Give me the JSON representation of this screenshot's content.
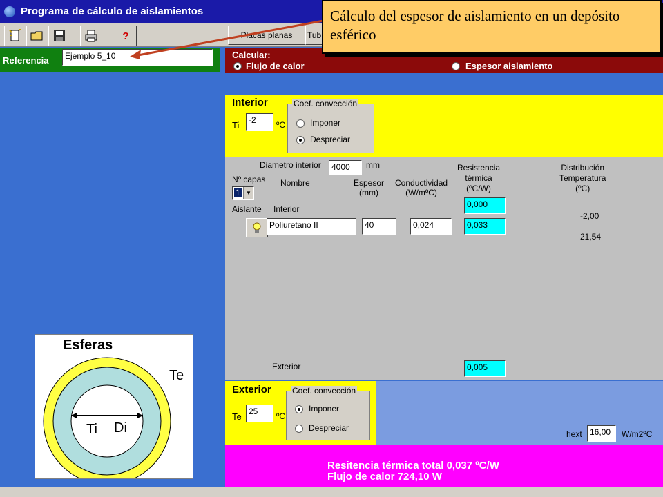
{
  "window": {
    "title": "Programa de cálculo de aislamientos"
  },
  "toolbar": {
    "new_icon": "new-document-icon",
    "open_icon": "open-folder-icon",
    "save_icon": "save-disk-icon",
    "print_icon": "printer-icon",
    "help_icon": "help-question-icon",
    "tab_placas": "Placas planas",
    "tab_tubos": "Tub"
  },
  "reference": {
    "label": "Referencia",
    "value": "Ejemplo 5_10"
  },
  "annotation": {
    "text": "Cálculo del espesor de aislamiento en un depósito esférico"
  },
  "calcular": {
    "label": "Calcular:",
    "option_flujo": "Flujo de calor",
    "option_espesor": "Espesor aislamiento",
    "selected": "Flujo de calor"
  },
  "interior": {
    "title": "Interior",
    "ti_label": "Ti",
    "ti_value": "-2",
    "unit": "ºC",
    "coef_title": "Coef. convección",
    "imponer": "Imponer",
    "despreciar": "Despreciar",
    "selected": "Despreciar"
  },
  "layers": {
    "diameter_label": "Diametro interior",
    "diameter_value": "4000",
    "diameter_unit": "mm",
    "ncapas_label": "Nº capas",
    "ncapas_value": "1",
    "header_nombre": "Nombre",
    "header_espesor": "Espesor\n(mm)",
    "header_conductividad": "Conductividad\n(W/mºC)",
    "header_resistencia": "Resistencia\ntérmica\n(ºC/W)",
    "header_distribucion": "Distribución\nTemperatura\n(ºC)",
    "aislante_label": "Aislante",
    "interior_label": "Interior",
    "interior_resistance": "0,000",
    "interior_temp": "-2,00",
    "layer_name": "Poliuretano II",
    "layer_espesor": "40",
    "layer_conductividad": "0,024",
    "layer_resistance": "0,033",
    "layer_temp": "21,54",
    "exterior_label": "Exterior",
    "exterior_resistance": "0,005"
  },
  "diagram": {
    "title": "Esferas",
    "te": "Te",
    "ti": "Ti",
    "di": "Di",
    "outer_color": "#ffff44",
    "middle_color": "#b0dede"
  },
  "exterior": {
    "title": "Exterior",
    "te_label": "Te",
    "te_value": "25",
    "unit": "ºC",
    "coef_title": "Coef. convección",
    "imponer": "Imponer",
    "despreciar": "Despreciar",
    "selected": "Imponer",
    "hext_label": "hext",
    "hext_value": "16,00",
    "hext_unit": "W/m2ºC"
  },
  "results": {
    "resistencia": "Resitencia térmica total 0,037 ºC/W",
    "flujo": "Flujo de calor 724,10 W"
  },
  "colors": {
    "title_bar": "#1a1aa8",
    "background": "#3a6fd0",
    "reference_bar": "#108010",
    "calc_bar": "#8b0a0a",
    "section_yellow": "#ffff00",
    "results_magenta": "#ff00ff",
    "result_cells": "#00ffff",
    "callout": "#ffcc66"
  }
}
